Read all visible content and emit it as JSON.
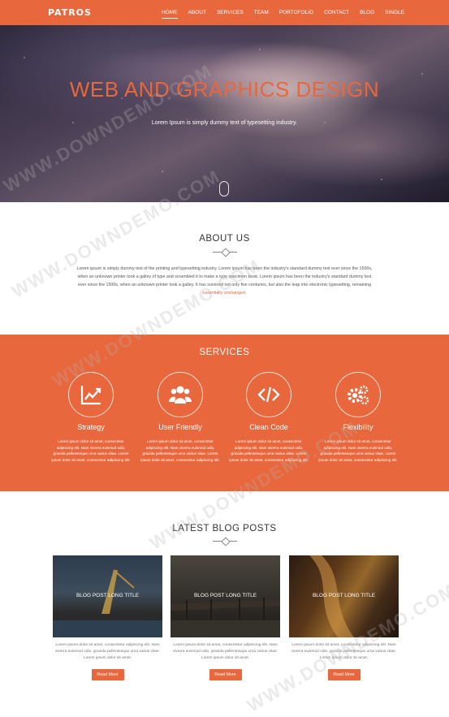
{
  "nav": {
    "logo": "PATROS",
    "items": [
      "HOME",
      "ABOUT",
      "SERVICES",
      "TEAM",
      "PORTOFOLIO",
      "CONTACT",
      "BLOG",
      "SINGLE"
    ]
  },
  "hero": {
    "title": "WEB AND GRAPHICS DESIGN",
    "subtitle": "Lorem Ipsum is simply dummy text of typesetting industry."
  },
  "about": {
    "title": "ABOUT US",
    "text": "Lorem ipsum is simply dummy text of the printing and typesetting industry. Lorem ipsum has been the industry's standard dummy text ever since the 1500s, when an unknown printer took a galley of type and scrambled it to make a type specimen book. Lorem ipsum has been the industry's standard dummy text ever since the 1500s, when an unknown printer took a galley. It has survived not only five centuries, but also the leap into electronic typesetting, remaining ",
    "highlight": "essentially unchanged."
  },
  "services": {
    "title": "SERVICES",
    "items": [
      {
        "name": "Strategy",
        "icon": "chart-line-icon",
        "desc": "Lorem ipsum dolor sit amet, consectetur adipiscing elit. Nam viverra euismod odio, gravida pellentesque urna varius vitae. Lorem ipsum dolor sit amet, consectetur adipiscing elit."
      },
      {
        "name": "User Friendly",
        "icon": "users-icon",
        "desc": "Lorem ipsum dolor sit amet, consectetur adipiscing elit. Nam viverra euismod odio, gravida pellentesque urna varius vitae. Lorem ipsum dolor sit amet, consectetur adipiscing elit."
      },
      {
        "name": "Clean Code",
        "icon": "code-icon",
        "desc": "Lorem ipsum dolor sit amet, consectetur adipiscing elit. Nam viverra euismod odio, gravida pellentesque urna varius vitae. Lorem ipsum dolor sit amet, consectetur adipiscing elit."
      },
      {
        "name": "Flexibility",
        "icon": "gears-icon",
        "desc": "Lorem ipsum dolor sit amet, consectetur adipiscing elit. Nam viverra euismod odio, gravida pellentesque urna varius vitae. Lorem ipsum dolor sit amet, consectetur adipiscing elit."
      }
    ]
  },
  "blog": {
    "title": "LATEST BLOG POSTS",
    "posts": [
      {
        "caption": "BLOG POST LONG TITLE",
        "text": "Lorem ipsum dolor sit amet, consectetur adipiscing elit. Nam viverra euismod odio, gravida pellentesque urna varius vitae. Lorem ipsum dolor sit amet.",
        "button": "Read More"
      },
      {
        "caption": "BLOG POST LONG TITLE",
        "text": "Lorem ipsum dolor sit amet, consectetur adipiscing elit. Nam viverra euismod odio, gravida pellentesque urna varius vitae. Lorem ipsum dolor sit amet.",
        "button": "Read More"
      },
      {
        "caption": "BLOG POST LONG TITLE",
        "text": "Lorem ipsum dolor sit amet, consectetur adipiscing elit. Nam viverra euismod odio, gravida pellentesque urna varius vitae. Lorem ipsum dolor sit amet.",
        "button": "Read More"
      }
    ]
  },
  "watermark": "WWW.DOWNDEMO.COM",
  "colors": {
    "accent": "#e8673c"
  }
}
